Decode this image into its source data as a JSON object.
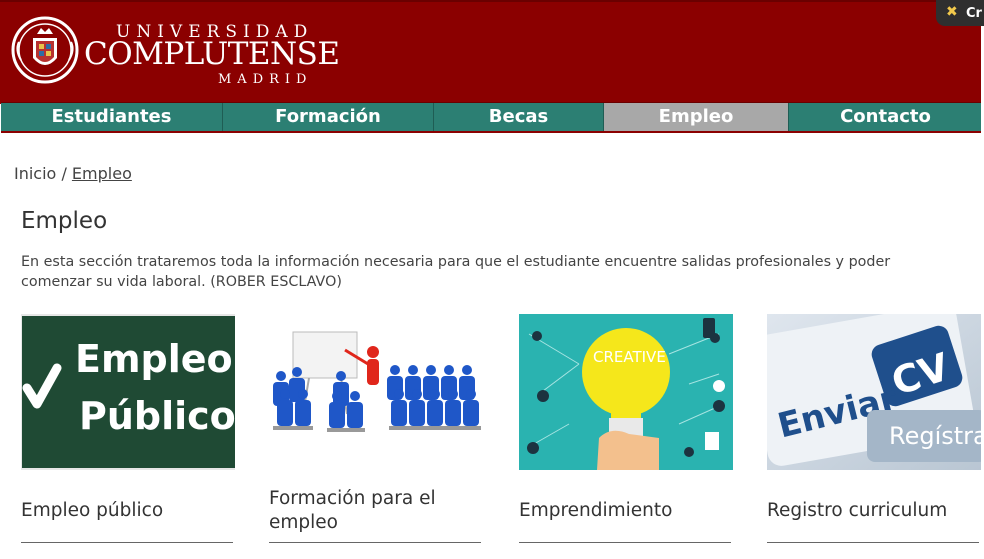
{
  "header": {
    "logo": {
      "line1": "UNIVERSIDAD",
      "line2": "COMPLUTENSE",
      "line3": "MADRID"
    },
    "background_color": "#8b0000",
    "extension_badge": {
      "icon": "x-icon",
      "label": "Cr"
    }
  },
  "nav": {
    "background_color": "#2c7f73",
    "active_color": "#a8a8a8",
    "items": [
      {
        "label": "Estudiantes",
        "active": false
      },
      {
        "label": "Formación",
        "active": false
      },
      {
        "label": "Becas",
        "active": false
      },
      {
        "label": "Empleo",
        "active": true
      },
      {
        "label": "Contacto",
        "active": false
      }
    ]
  },
  "breadcrumb": {
    "home": "Inicio",
    "separator": "/",
    "current": "Empleo"
  },
  "main": {
    "title": "Empleo",
    "intro": "En esta sección trataremos toda la información necesaria para que el estudiante encuentre salidas profesionales y poder comenzar su vida laboral. (ROBER ESCLAVO)",
    "cards": [
      {
        "title": "Empleo público",
        "image_text_line1": "Empleo",
        "image_text_line2": "Público"
      },
      {
        "title": "Formación para el empleo"
      },
      {
        "title": "Emprendimiento",
        "image_text": "CREATIVE"
      },
      {
        "title": "Registro curriculum",
        "image_text_cv": "CV",
        "image_text_enviar": "Enviar",
        "image_text_registra": "Regístra"
      }
    ]
  }
}
